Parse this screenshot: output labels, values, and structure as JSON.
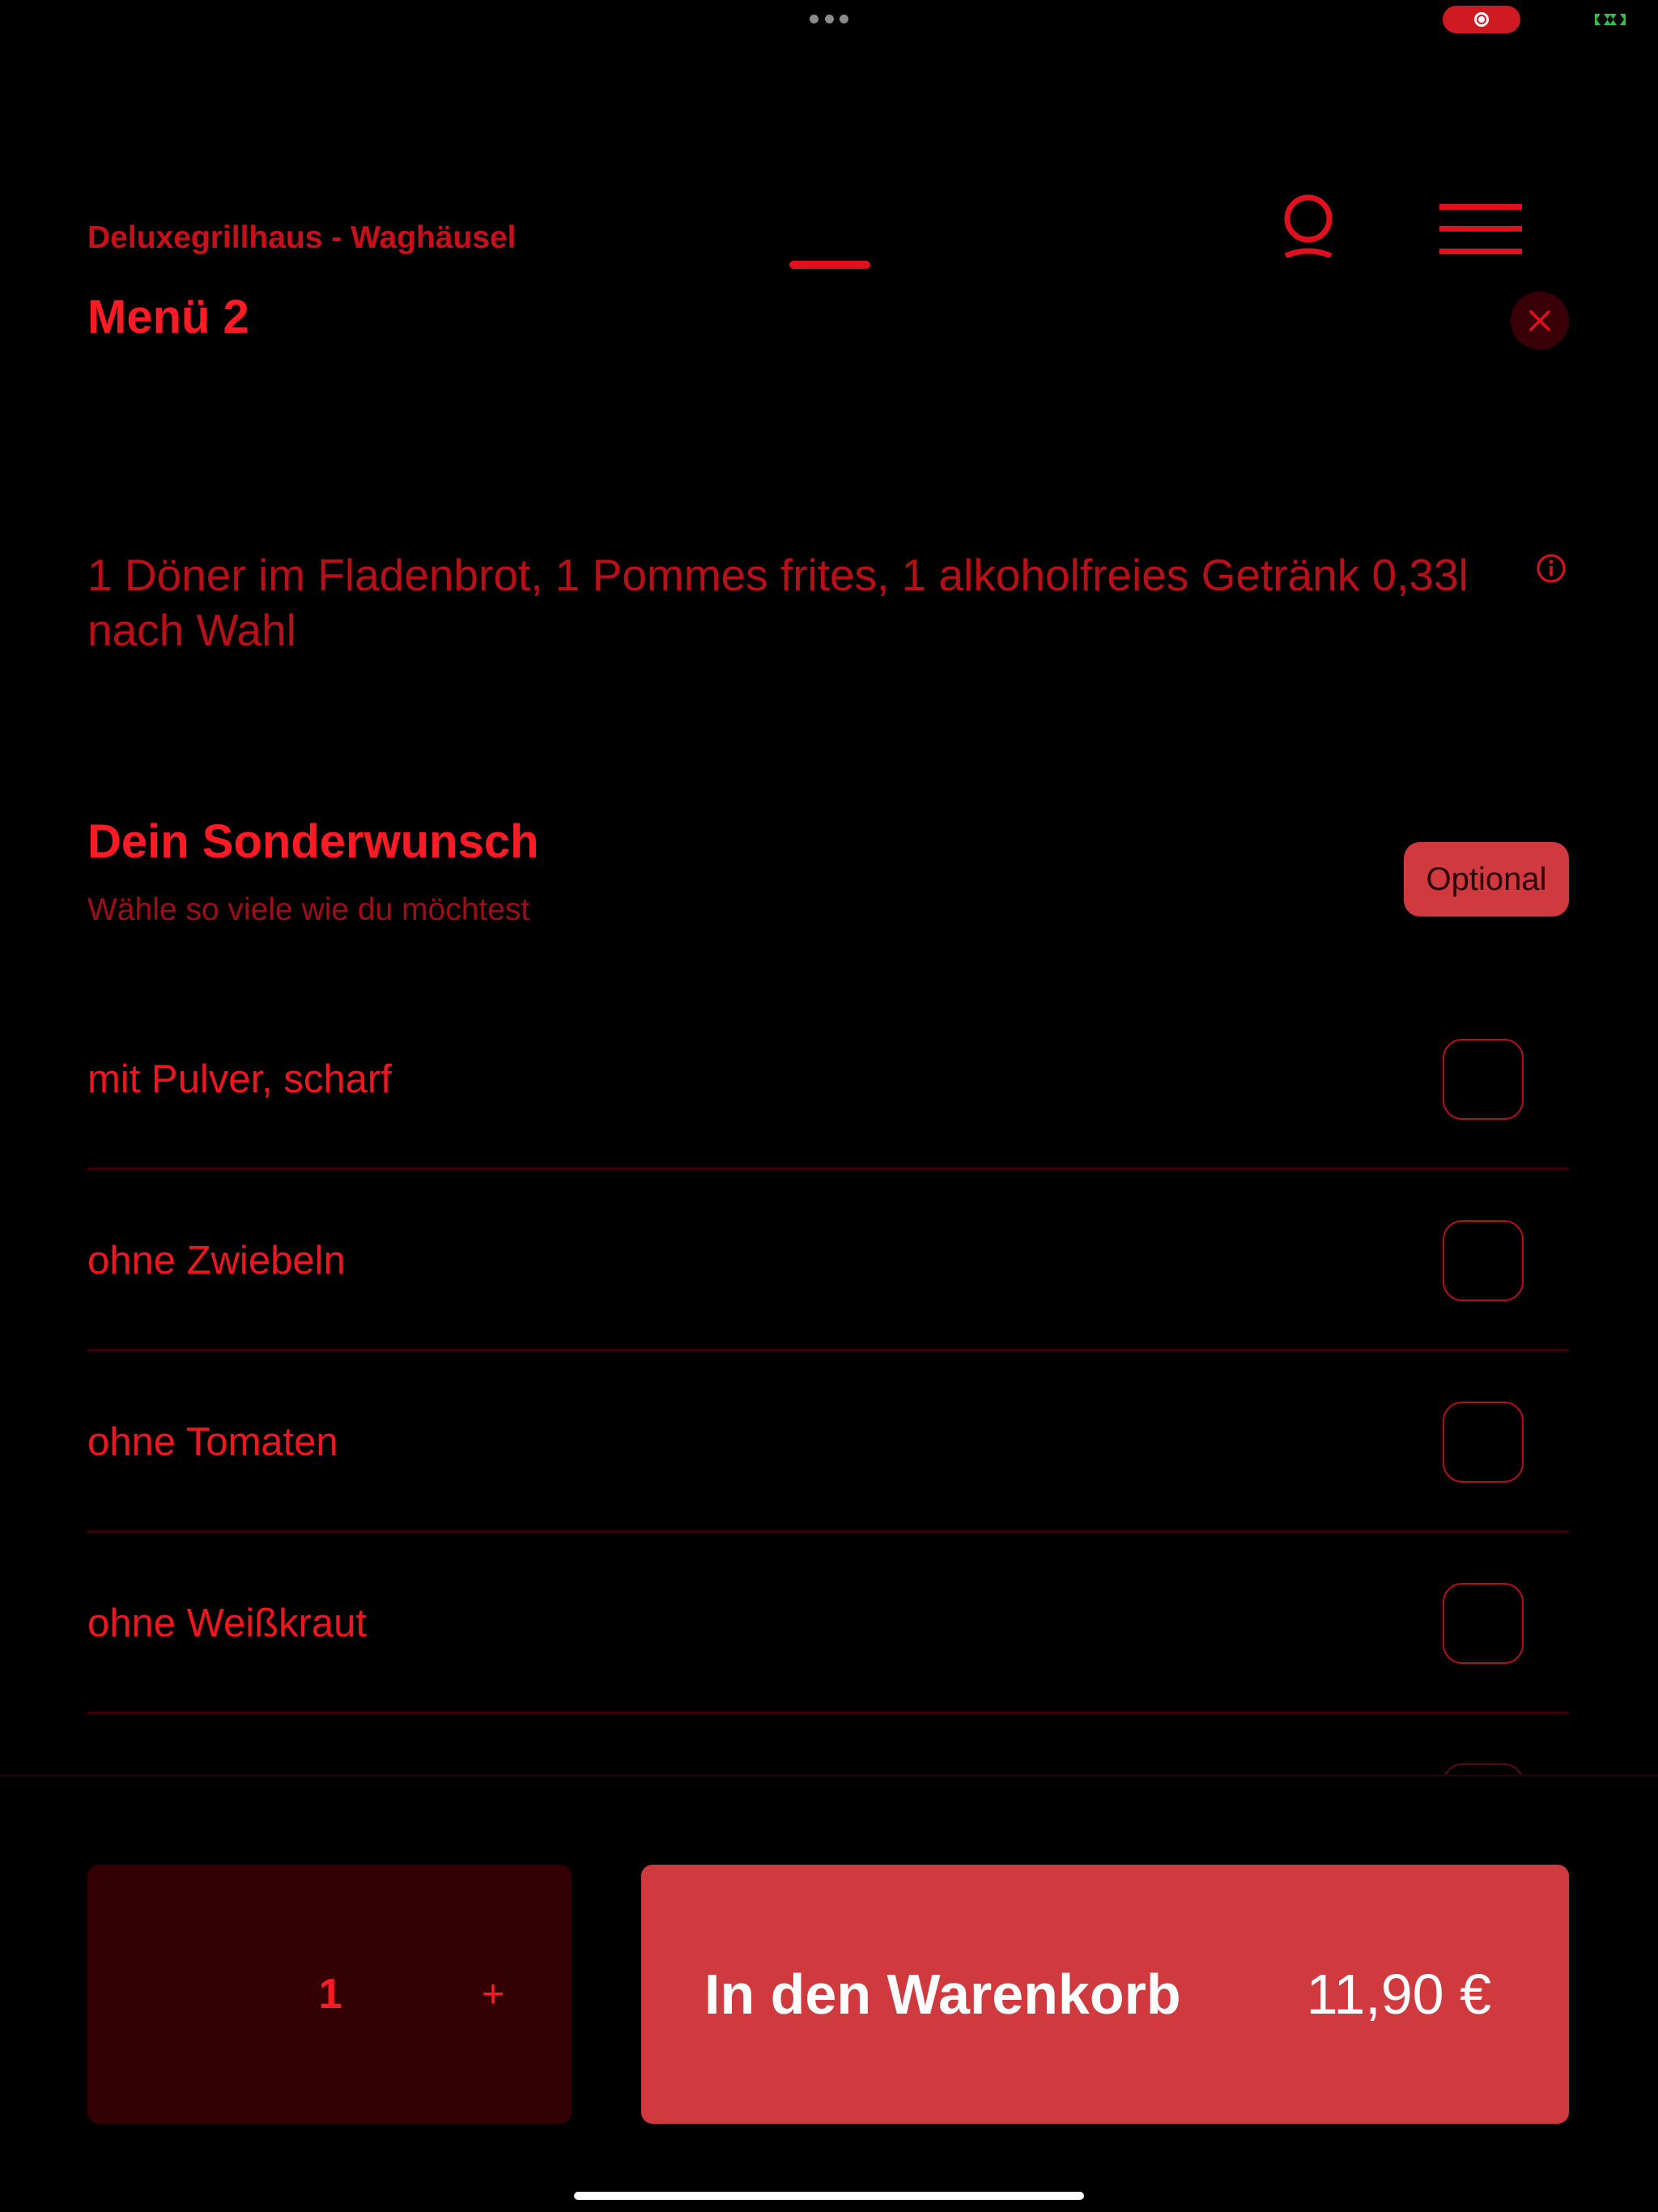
{
  "header": {
    "restaurant_name": "Deluxegrillhaus - Waghäusel"
  },
  "item": {
    "title": "Menü 2",
    "description": "1 Döner im Fladenbrot, 1 Pommes frites, 1 alkoholfreies Getränk 0,33l nach Wahl"
  },
  "section": {
    "title": "Dein Sonderwunsch",
    "subtitle": "Wähle so viele wie du möchtest",
    "badge": "Optional"
  },
  "options": [
    {
      "label": "mit Pulver, scharf",
      "checked": false
    },
    {
      "label": "ohne Zwiebeln",
      "checked": false
    },
    {
      "label": "ohne Tomaten",
      "checked": false
    },
    {
      "label": "ohne Weißkraut",
      "checked": false
    }
  ],
  "footer": {
    "quantity": "1",
    "plus_label": "+",
    "cart_label": "In den Warenkorb",
    "price": "11,90 €"
  },
  "colors": {
    "accent": "#e0101c",
    "button": "#d03a3f",
    "stepper_bg": "#330004",
    "background": "#000000"
  },
  "icons": [
    "user-icon",
    "hamburger-menu-icon",
    "close-icon",
    "info-icon",
    "screen-record-icon",
    "battery-icon"
  ]
}
